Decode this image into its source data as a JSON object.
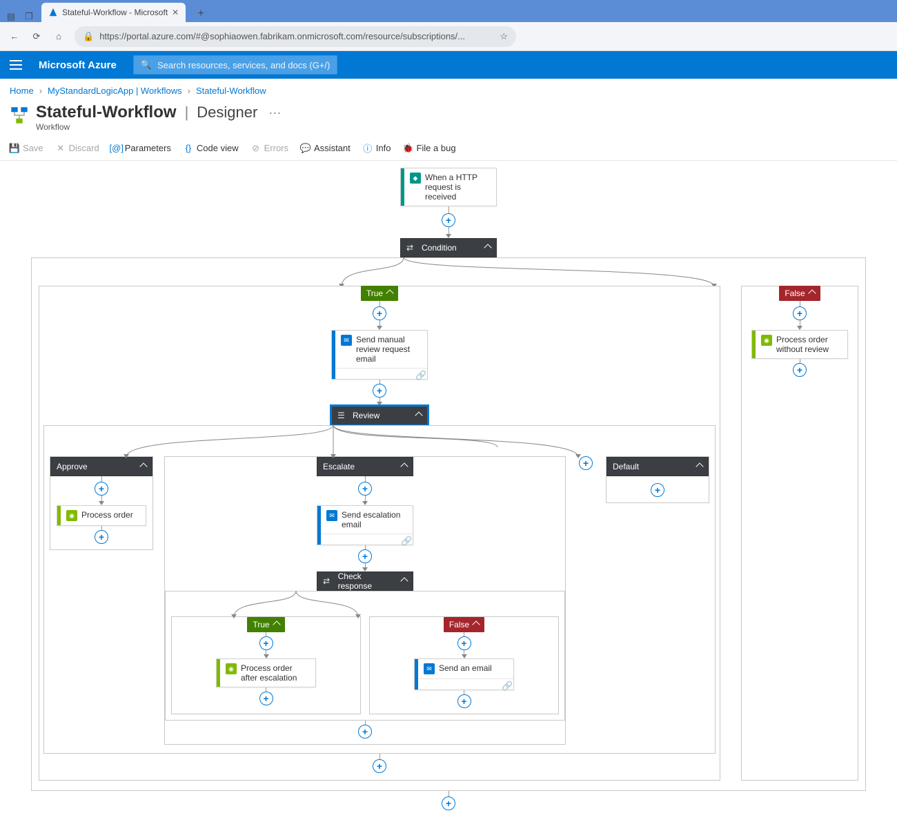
{
  "browser": {
    "tab_title": "Stateful-Workflow - Microsoft",
    "url": "https://portal.azure.com/#@sophiaowen.fabrikam.onmicrosoft.com/resource/subscriptions/..."
  },
  "azure": {
    "brand": "Microsoft Azure",
    "search_placeholder": "Search resources, services, and docs (G+/)"
  },
  "breadcrumb": {
    "home": "Home",
    "app": "MyStandardLogicApp | Workflows",
    "workflow": "Stateful-Workflow"
  },
  "page": {
    "title": "Stateful-Workflow",
    "section": "Designer",
    "type": "Workflow"
  },
  "toolbar": {
    "save": "Save",
    "discard": "Discard",
    "parameters": "Parameters",
    "code_view": "Code view",
    "errors": "Errors",
    "assistant": "Assistant",
    "info": "Info",
    "file_bug": "File a bug"
  },
  "nodes": {
    "trigger": "When a HTTP request is received",
    "condition": "Condition",
    "true": "True",
    "false": "False",
    "send_manual_review": "Send manual review request email",
    "process_no_review": "Process order without review",
    "review": "Review",
    "approve": "Approve",
    "escalate": "Escalate",
    "default": "Default",
    "process_order": "Process order",
    "send_escalation": "Send escalation email",
    "check_response": "Check response",
    "process_after_escalation": "Process order after escalation",
    "send_an_email": "Send an email"
  }
}
